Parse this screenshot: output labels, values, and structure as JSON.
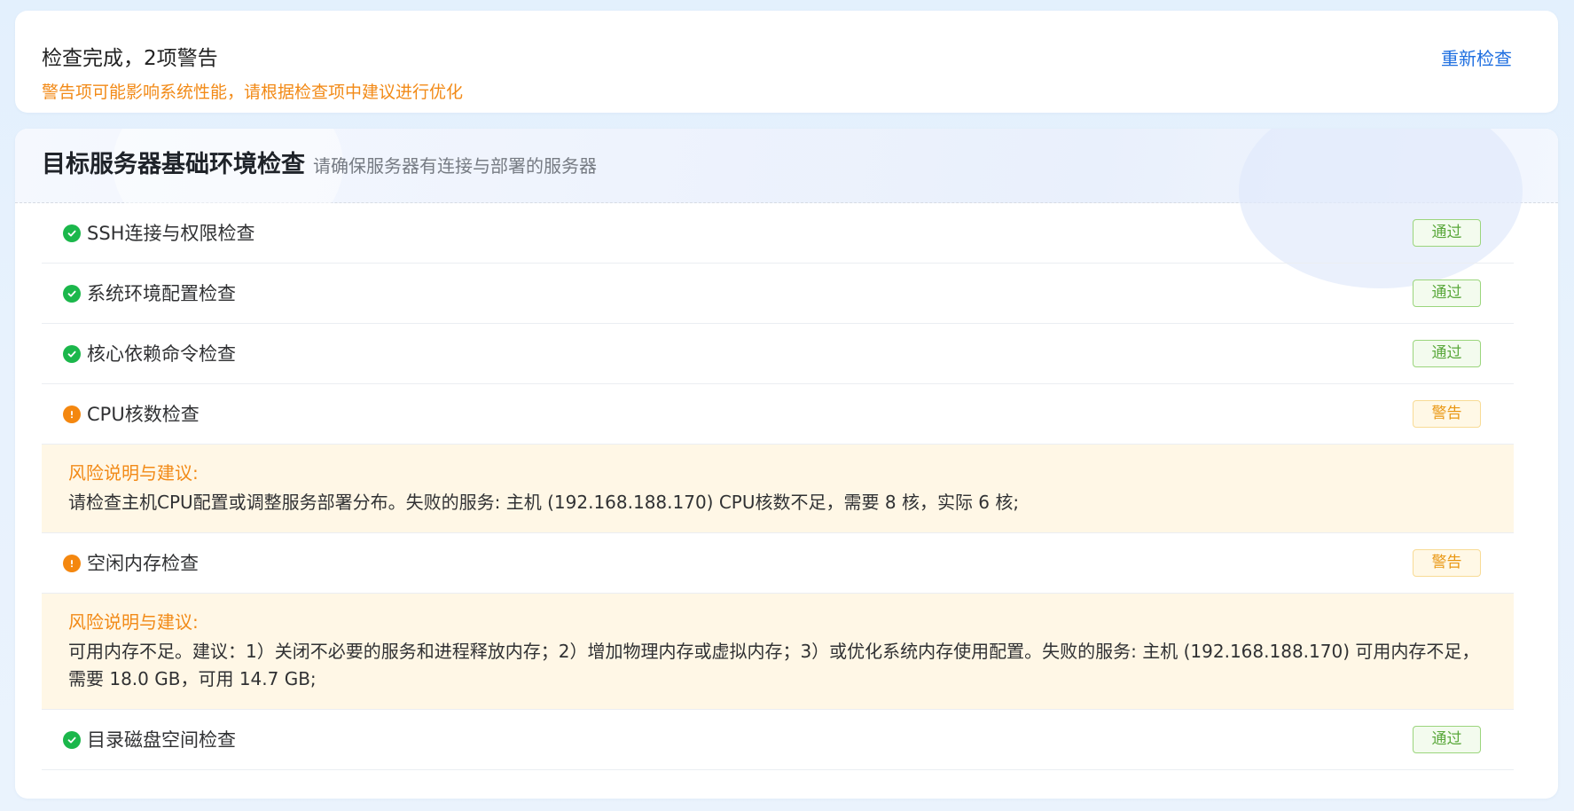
{
  "summary": {
    "title": "检查完成，2项警告",
    "subtitle": "警告项可能影响系统性能，请根据检查项中建议进行优化",
    "recheck_label": "重新检查"
  },
  "section": {
    "title": "目标服务器基础环境检查",
    "subtitle": "请确保服务器有连接与部署的服务器"
  },
  "colors": {
    "pass": "#1bb74b",
    "warning": "#f4870f",
    "link": "#1f6fe0"
  },
  "checks": [
    {
      "label": "SSH连接与权限检查",
      "status": "通过",
      "icon": "check-circle-icon"
    },
    {
      "label": "系统环境配置检查",
      "status": "通过",
      "icon": "check-circle-icon"
    },
    {
      "label": "核心依赖命令检查",
      "status": "通过",
      "icon": "check-circle-icon"
    },
    {
      "label": "CPU核数检查",
      "status": "警告",
      "icon": "warning-circle-icon",
      "risk_title": "风险说明与建议:",
      "risk_text": "请检查主机CPU配置或调整服务部署分布。失败的服务: 主机 (192.168.188.170) CPU核数不足，需要 8 核，实际 6 核;"
    },
    {
      "label": "空闲内存检查",
      "status": "警告",
      "icon": "warning-circle-icon",
      "risk_title": "风险说明与建议:",
      "risk_text": "可用内存不足。建议：1）关闭不必要的服务和进程释放内存；2）增加物理内存或虚拟内存；3）或优化系统内存使用配置。失败的服务: 主机 (192.168.188.170) 可用内存不足，需要 18.0 GB，可用 14.7 GB;"
    },
    {
      "label": "目录磁盘空间检查",
      "status": "通过",
      "icon": "check-circle-icon"
    }
  ]
}
